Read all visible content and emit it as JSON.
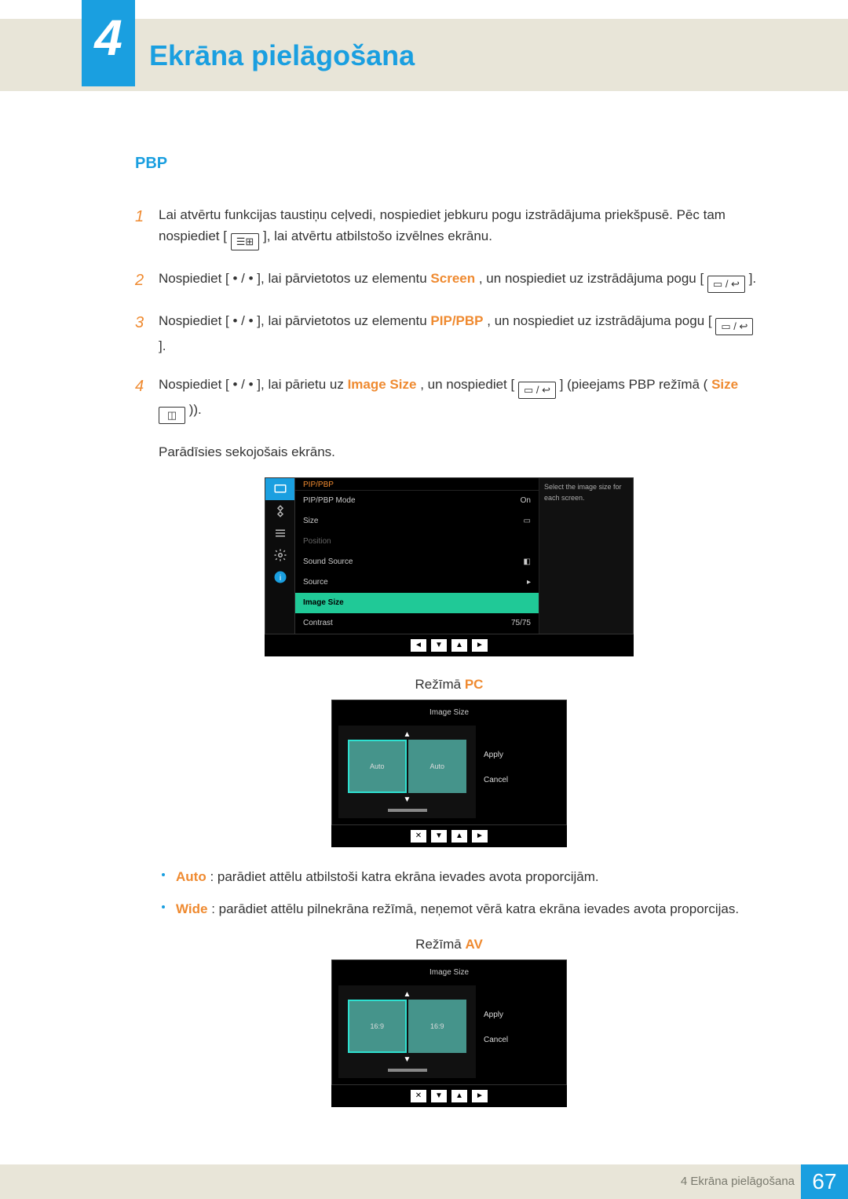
{
  "chapter": {
    "number": "4",
    "title": "Ekrāna pielāgošana"
  },
  "section": {
    "title": "PBP"
  },
  "steps": [
    {
      "n": "1",
      "pre": "Lai atvērtu funkcijas taustiņu ceļvedi, nospiediet jebkuru pogu izstrādājuma priekšpusē. Pēc tam nospiediet [",
      "icon": "menu-icon",
      "post": "], lai atvērtu atbilstošo izvēlnes ekrānu."
    },
    {
      "n": "2",
      "pre": "Nospiediet [ • / • ], lai pārvietotos uz elementu ",
      "hl": "Screen",
      "mid": ", un nospiediet uz izstrādājuma pogu [",
      "icon": "enter-icon",
      "post": "]."
    },
    {
      "n": "3",
      "pre": "Nospiediet [ • / • ], lai pārvietotos uz elementu ",
      "hl": "PIP/PBP",
      "mid": ", un nospiediet uz izstrādājuma pogu [",
      "icon": "enter-icon",
      "post": "]."
    },
    {
      "n": "4",
      "pre": "Nospiediet [ • / • ], lai pārietu uz ",
      "hl": "Image Size",
      "mid": ", un nospiediet [",
      "icon": "enter-icon",
      "post": "] (pieejams PBP režīmā (",
      "hl2": "Size",
      "tail": " ",
      "icon2": "pbp-size-icon",
      "close": "))."
    }
  ],
  "appears_text": "Parādīsies sekojošais ekrāns.",
  "osd": {
    "header": "PIP/PBP",
    "hint": "Select the image size for each screen.",
    "rows": [
      {
        "label": "PIP/PBP Mode",
        "value": "On",
        "state": "normal"
      },
      {
        "label": "Size",
        "value": "▭",
        "state": "normal"
      },
      {
        "label": "Position",
        "value": "",
        "state": "dim"
      },
      {
        "label": "Sound Source",
        "value": "◧",
        "state": "normal"
      },
      {
        "label": "Source",
        "value": "▸",
        "state": "normal"
      },
      {
        "label": "Image Size",
        "value": "",
        "state": "sel"
      },
      {
        "label": "Contrast",
        "value": "75/75",
        "state": "normal"
      }
    ],
    "nav": [
      "◄",
      "▼",
      "▲",
      "►"
    ],
    "side_active_index": 0
  },
  "mode_pc": {
    "prefix": "Režīmā ",
    "hl": "PC"
  },
  "mode_av": {
    "prefix": "Režīmā ",
    "hl": "AV"
  },
  "preview_pc": {
    "title": "Image Size",
    "left": "Auto",
    "right": "Auto",
    "apply": "Apply",
    "cancel": "Cancel",
    "nav": [
      "✕",
      "▼",
      "▲",
      "►"
    ]
  },
  "preview_av": {
    "title": "Image Size",
    "left": "16:9",
    "right": "16:9",
    "apply": "Apply",
    "cancel": "Cancel",
    "nav": [
      "✕",
      "▼",
      "▲",
      "►"
    ]
  },
  "bullets": [
    {
      "hl": "Auto",
      "text": ": parādiet attēlu atbilstoši katra ekrāna ievades avota proporcijām."
    },
    {
      "hl": "Wide",
      "text": ": parādiet attēlu pilnekrāna režīmā, neņemot vērā katra ekrāna ievades avota proporcijas."
    }
  ],
  "footer": {
    "text": "4 Ekrāna pielāgošana",
    "page": "67"
  },
  "icons": {
    "menu-icon": "☰⊞",
    "enter-icon": "▭ / ↩",
    "pbp-size-icon": "◫"
  }
}
